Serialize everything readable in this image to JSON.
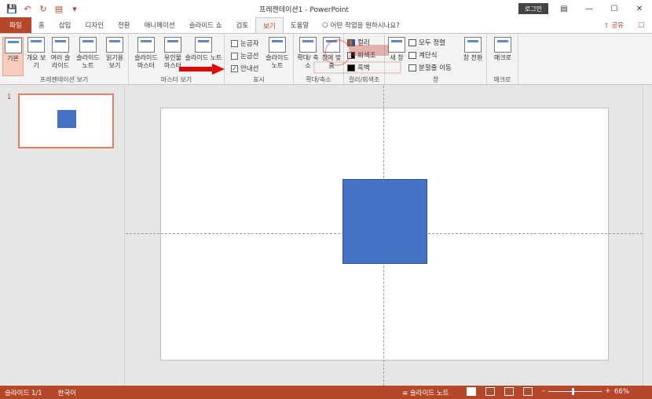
{
  "app": {
    "title": "프레젠테이션1 - PowerPoint",
    "login": "로그인"
  },
  "tabs": [
    "파일",
    "홈",
    "삽입",
    "디자인",
    "전환",
    "애니메이션",
    "슬라이드 쇼",
    "검토",
    "보기",
    "도움말"
  ],
  "tell_me": "어떤 작업을 원하시나요?",
  "share": "공유",
  "ribbon": {
    "presentation_views": {
      "label": "프레젠테이션 보기",
      "buttons": [
        "기본",
        "개요 보기",
        "여러 슬라이드",
        "슬라이드 노트",
        "읽기용 보기"
      ]
    },
    "master_views": {
      "label": "마스터 보기",
      "buttons": [
        "슬라이드 마스터",
        "유인물 마스터",
        "슬라이드 노트"
      ]
    },
    "show": {
      "label": "표시",
      "ruler": "눈금자",
      "gridlines": "눈금선",
      "guides": "안내선",
      "ruler_checked": false,
      "gridlines_checked": false,
      "guides_checked": true,
      "notes_button": "슬라이드 노트"
    },
    "zoom": {
      "label": "확대/축소",
      "zoom_button": "확대/ 축소",
      "fit_button": "창에 맞춤"
    },
    "color": {
      "label": "컬러/회색조",
      "color": "컬러",
      "grayscale": "회색조",
      "bw": "흑백"
    },
    "window": {
      "label": "창",
      "new_window": "새 창",
      "arrange_all": "모두 정렬",
      "cascade": "계단식",
      "move_split": "분할줄 이동",
      "switch_windows": "창 전환"
    },
    "macros": {
      "label": "매크로",
      "macro_button": "매크로"
    }
  },
  "slides": {
    "thumb_number": "1"
  },
  "statusbar": {
    "slide_info": "슬라이드 1/1",
    "language": "한국어",
    "notes": "슬라이드 노트",
    "zoom": "66%"
  },
  "colors": {
    "accent": "#b7472a",
    "shape_fill": "#4472c4",
    "arrow": "#e60000"
  }
}
